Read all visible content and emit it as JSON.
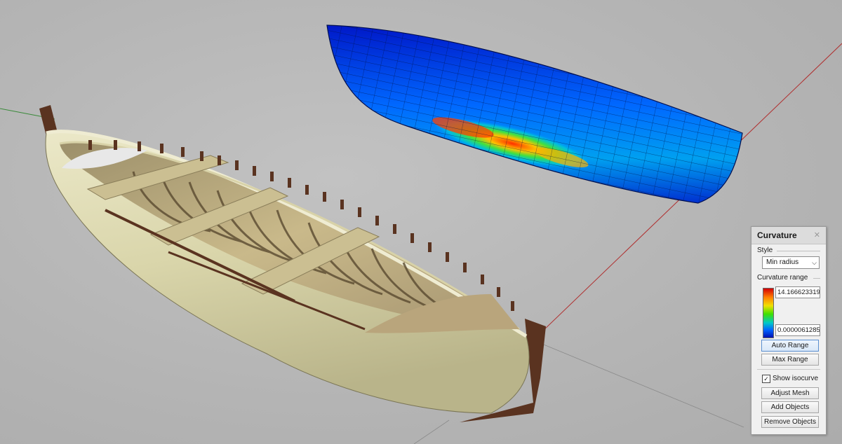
{
  "panel": {
    "title": "Curvature",
    "close_icon": "close-icon",
    "style_label": "Style",
    "style_value": "Min radius",
    "curvature_range_label": "Curvature range",
    "range_max": "14.166623319",
    "range_min": "0.0000061285",
    "gradient_colors": [
      "#d40000",
      "#ff8000",
      "#f0e000",
      "#40e000",
      "#00c8c8",
      "#0060ff",
      "#0010b0"
    ],
    "auto_range_label": "Auto Range",
    "max_range_label": "Max Range",
    "show_isocurve_label": "Show isocurve",
    "show_isocurve_checked": true,
    "adjust_mesh_label": "Adjust Mesh",
    "add_objects_label": "Add Objects",
    "remove_objects_label": "Remove Objects"
  },
  "viewport": {
    "background": "#b6b6b6",
    "hull_color": "#ddd9b4",
    "wood_color": "#5a3320",
    "axis_x_color": "#b03030",
    "axis_y_color": "#3a8a3a"
  }
}
